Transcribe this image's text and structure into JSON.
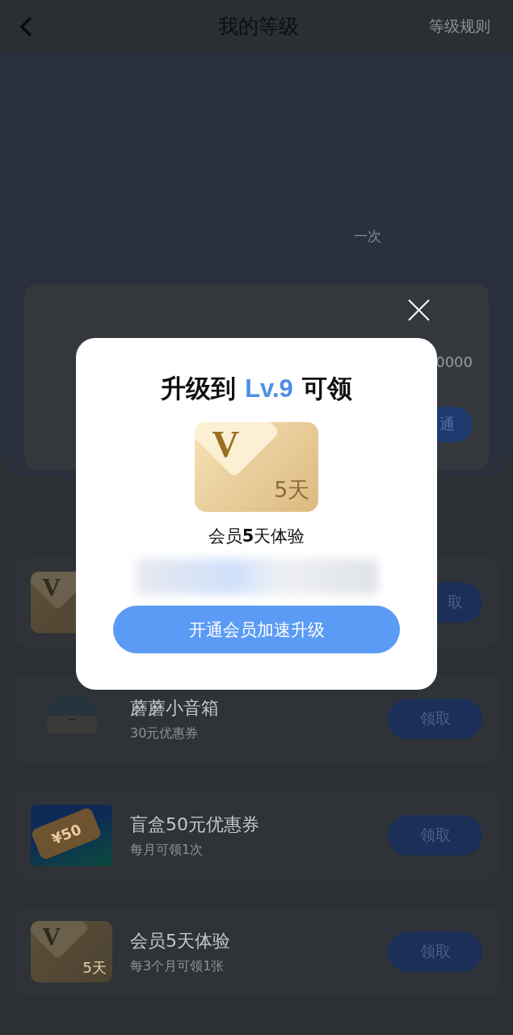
{
  "header": {
    "title": "我的等级",
    "rules_link": "等级规则"
  },
  "level_panel": {
    "hint": "一次",
    "card_value": "0000",
    "card_button": "通"
  },
  "rewards": [
    {
      "icon": {
        "kind": "vip",
        "letter": "V"
      },
      "button": "取"
    },
    {
      "icon": {
        "kind": "speaker"
      },
      "title": "蘑蘑小音箱",
      "subtitle": "30元优惠券",
      "button": "领取"
    },
    {
      "icon": {
        "kind": "coupon",
        "text": "¥50"
      },
      "title": "盲盒50元优惠券",
      "subtitle": "每月可领1次",
      "button": "领取"
    },
    {
      "icon": {
        "kind": "vip",
        "letter": "V",
        "days": "5天"
      },
      "title": "会员5天体验",
      "subtitle": "每3个月可领1张",
      "button": "领取"
    }
  ],
  "dialog": {
    "title_before": "升级到",
    "level": "Lv.9",
    "title_after": "可领",
    "icon": {
      "kind": "vip",
      "letter": "V",
      "days": "5天"
    },
    "reward_name": "会员**5**天体验",
    "button": "开通会员加速升级"
  }
}
